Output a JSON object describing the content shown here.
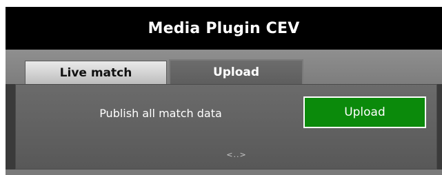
{
  "window": {
    "title": "Media Plugin CEV"
  },
  "tabs": [
    {
      "label": "Live match",
      "active": true
    },
    {
      "label": "Upload",
      "active": false
    }
  ],
  "panel": {
    "publish_label": "Publish all match data",
    "upload_button_label": "Upload",
    "pager_text": "<..>"
  },
  "colors": {
    "title_bar": "#000000",
    "upload_button": "#0b8a0b",
    "panel_bg": "#626262"
  }
}
